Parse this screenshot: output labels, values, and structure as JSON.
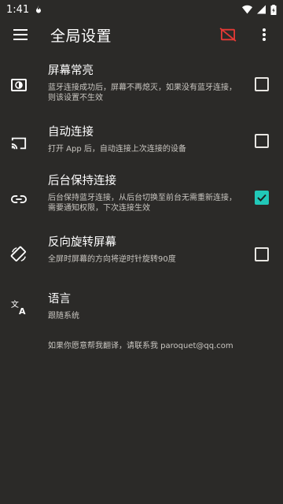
{
  "status_bar": {
    "time": "1:41",
    "icons": [
      "fire-icon",
      "wifi-icon",
      "signal-icon",
      "battery-icon"
    ]
  },
  "app_bar": {
    "title": "全局设置",
    "menu_icon": "menu-icon",
    "bluetooth_off_icon": "cast-off-icon",
    "more_icon": "more-vert-icon",
    "accent_red": "#e53935"
  },
  "settings": {
    "items": [
      {
        "title": "屏幕常亮",
        "summary_line1": "蓝牙连接成功后，屏幕不再熄灭，如果没有蓝牙连接，",
        "summary_line2": "则该设置不生效",
        "icon": "brightness-icon",
        "checked": false
      },
      {
        "title": "自动连接",
        "summary_line1": "打开 App 后，自动连接上次连接的设备",
        "summary_line2": "",
        "icon": "cast-icon",
        "checked": false
      },
      {
        "title": "后台保持连接",
        "summary_line1": "后台保持蓝牙连接，从后台切换至前台无需重新连接，",
        "summary_line2": "需要通知权限，下次连接生效",
        "icon": "link-icon",
        "checked": true
      },
      {
        "title": "反向旋转屏幕",
        "summary_line1": "全屏时屏幕的方向将逆时针旋转90度",
        "summary_line2": "",
        "icon": "screen-rotation-icon",
        "checked": false
      },
      {
        "title": "语言",
        "summary_line1": "跟随系统",
        "summary_line2": "",
        "icon": "translate-icon",
        "checked": null
      }
    ],
    "footnote": "如果你愿意帮我翻译，请联系我 paroquet@qq.com"
  },
  "colors": {
    "background": "#2b2a28",
    "checkbox_checked": "#21c8b8"
  }
}
